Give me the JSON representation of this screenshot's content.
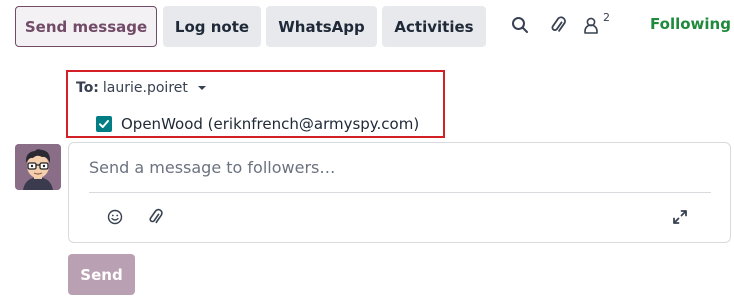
{
  "toolbar": {
    "send_message_label": "Send message",
    "log_note_label": "Log note",
    "whatsapp_label": "WhatsApp",
    "activities_label": "Activities",
    "follower_count": "2",
    "following_label": "Following"
  },
  "recipients": {
    "to_label": "To:",
    "to_value": "laurie.poiret",
    "follower_option": "OpenWood (eriknfrench@armyspy.com)",
    "follower_checked": true
  },
  "composer": {
    "placeholder": "Send a message to followers…"
  },
  "send_button": {
    "label": "Send"
  },
  "colors": {
    "accent": "#714b67",
    "following": "#1f8a3c",
    "checkbox": "#017e84",
    "highlight_border": "#d31f26"
  }
}
